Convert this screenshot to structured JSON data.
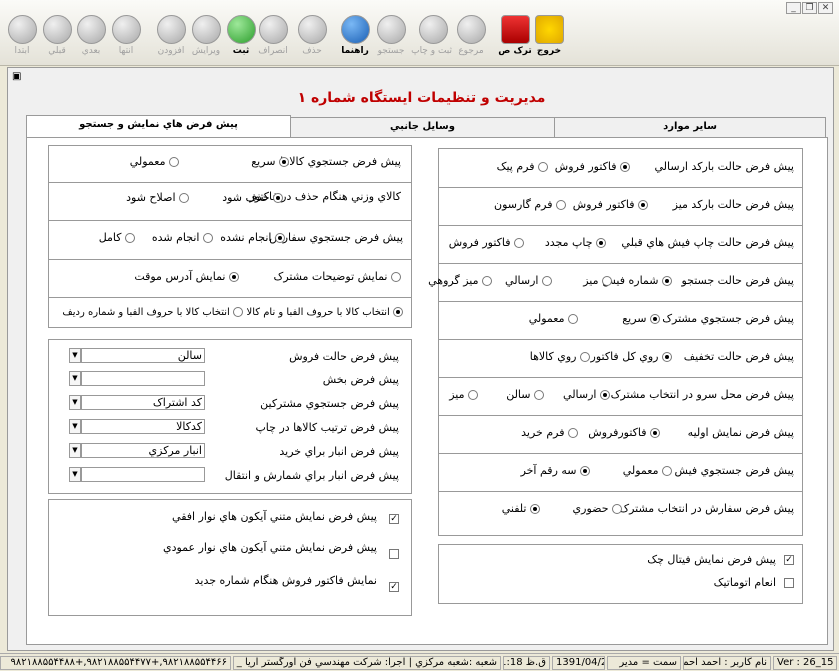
{
  "toolbar": {
    "items": [
      {
        "label": "خروج",
        "icon": "exit-icon",
        "active": true
      },
      {
        "label": "ترک ص",
        "icon": "lock-icon",
        "active": true
      },
      {
        "label": "مرجوع",
        "icon": "return-icon",
        "active": false
      },
      {
        "label": "ثبت و چاپ",
        "icon": "print-icon",
        "active": false
      },
      {
        "label": "جستجو",
        "icon": "search-icon",
        "active": false
      },
      {
        "label": "راهنما",
        "icon": "help-icon",
        "active": true
      },
      {
        "label": "حذف",
        "icon": "delete-icon",
        "active": false
      },
      {
        "label": "انصراف",
        "icon": "cancel-icon",
        "active": false
      },
      {
        "label": "ثبت",
        "icon": "check-icon",
        "active": true
      },
      {
        "label": "ويرايش",
        "icon": "edit-icon",
        "active": false
      },
      {
        "label": "افزودن",
        "icon": "add-icon",
        "active": false
      },
      {
        "label": "انتها",
        "icon": "last-icon",
        "active": false
      },
      {
        "label": "بعدي",
        "icon": "next-icon",
        "active": false
      },
      {
        "label": "قبلي",
        "icon": "prev-icon",
        "active": false
      },
      {
        "label": "ابتدا",
        "icon": "first-icon",
        "active": false
      }
    ]
  },
  "window": {
    "title": "مديريت و تنظيمات ايستگاه شماره ۱"
  },
  "tabs": [
    "ساير موارد",
    "وسايل جانبي",
    "پيش فرض هاي نمايش و جستجو"
  ],
  "right": {
    "rows": [
      {
        "label": "پيش فرض حالت بارکد ارسالي",
        "options": [
          "فاکتور فروش",
          "فرم پيک"
        ],
        "selected": 0
      },
      {
        "label": "پيش فرض حالت بارکد ميز",
        "options": [
          "فاکتور فروش",
          "فرم گارسون"
        ],
        "selected": 0
      },
      {
        "label": "پيش فرض حالت چاپ فيش هاي قبلي",
        "options": [
          "چاپ مجدد",
          "فاکتور فروش"
        ],
        "selected": 0
      },
      {
        "label": "پيش فرض حالت جستجو",
        "options": [
          "شماره فيش",
          "ميز",
          "ارسالي",
          "ميز گروهي"
        ],
        "selected": 0
      },
      {
        "label": "پيش فرض جستجوي مشترک",
        "options": [
          "سريع",
          "معمولي"
        ],
        "selected": 0
      },
      {
        "label": "پيش فرض حالت تخفيف",
        "options": [
          "روي کل فاکتور",
          "روي کالاها"
        ],
        "selected": 0
      },
      {
        "label": "پيش فرض محل سرو در انتخاب مشترک",
        "options": [
          "ارسالي",
          "سالن",
          "ميز"
        ],
        "selected": 0
      },
      {
        "label": "پيش فرض  نمايش اوليه",
        "options": [
          "فاکتورفروش",
          "فرم خريد"
        ],
        "selected": 0
      },
      {
        "label": "پيش فرض جستجوي فيش",
        "options": [
          "معمولي",
          "سه رقم آخر"
        ],
        "selected": 1
      },
      {
        "label": "پيش فرض سفارش در انتخاب مشترک",
        "options": [
          "حضوري",
          "تلفني"
        ],
        "selected": 1
      }
    ],
    "checks": [
      {
        "label": "پيش فرض نمايش فيتال چک",
        "checked": true
      },
      {
        "label": "انعام اتوماتيک",
        "checked": false
      }
    ]
  },
  "left": {
    "row1": {
      "label": "پيش فرض جستجوي کالاها",
      "options": [
        "سريع",
        "معمولي"
      ],
      "selected": 0
    },
    "row2": {
      "label": "کالاي وزني هنگام حذف در فاکتور",
      "options": [
        "حذف شود",
        "اصلاح شود"
      ],
      "selected": 0
    },
    "row3": {
      "label": "پيش فرض جستجوي سفارش",
      "options": [
        "انجام نشده",
        "انجام شده",
        "کامل"
      ],
      "selected": 0
    },
    "row4": {
      "options": [
        "نمايش توضيحات مشترک",
        "نمايش آدرس موقت"
      ],
      "selected": 1
    },
    "row5": {
      "options": [
        "انتخاب کالا با حروف الفبا و نام کالا",
        "انتخاب کالا با حروف الفبا و شماره رديف"
      ],
      "selected": 0
    },
    "selects": [
      {
        "label": "پيش فرض حالت فروش",
        "value": "سالن"
      },
      {
        "label": "پيش فرض بخش",
        "value": ""
      },
      {
        "label": "پيش فرض جستجوي مشترکين",
        "value": "کد اشتراک"
      },
      {
        "label": "پيش فرض ترتيب کالاها در چاپ",
        "value": "کدکالا"
      },
      {
        "label": "پيش فرض انبار براي خريد",
        "value": "انبار مرکزي"
      },
      {
        "label": "پيش فرض انبار براي شمارش و انتقال",
        "value": ""
      }
    ],
    "checks": [
      {
        "label": "پيش فرض نمايش متني آيکون هاي نوار افقي",
        "checked": true
      },
      {
        "label": "پيش فرض نمايش متني آيکون هاي نوار عمودي",
        "checked": false
      },
      {
        "label": "نمايش فاکتور فروش هنگام شماره جديد",
        "checked": true
      }
    ]
  },
  "status": {
    "ver": "Ver : 26_15",
    "user": "نام کاربر : احمد احمدي",
    "role": "سمت = مدير",
    "date": "1391/04/27",
    "time": "ق.ظ 11:18",
    "branch": "شعبه :شعبه مرکزي | اجرا: شرکت مهندسي فن آورگستر آريا _ تلفن: +۹۸۲۱۸۸۵۵۴۴۵۵",
    "phones": "۹۸۲۱۸۸۵۵۴۴۶۶,+۹۸۲۱۸۸۵۵۴۴۷۷,+۹۸۲۱۸۸۵۵۴۴۸۸"
  }
}
